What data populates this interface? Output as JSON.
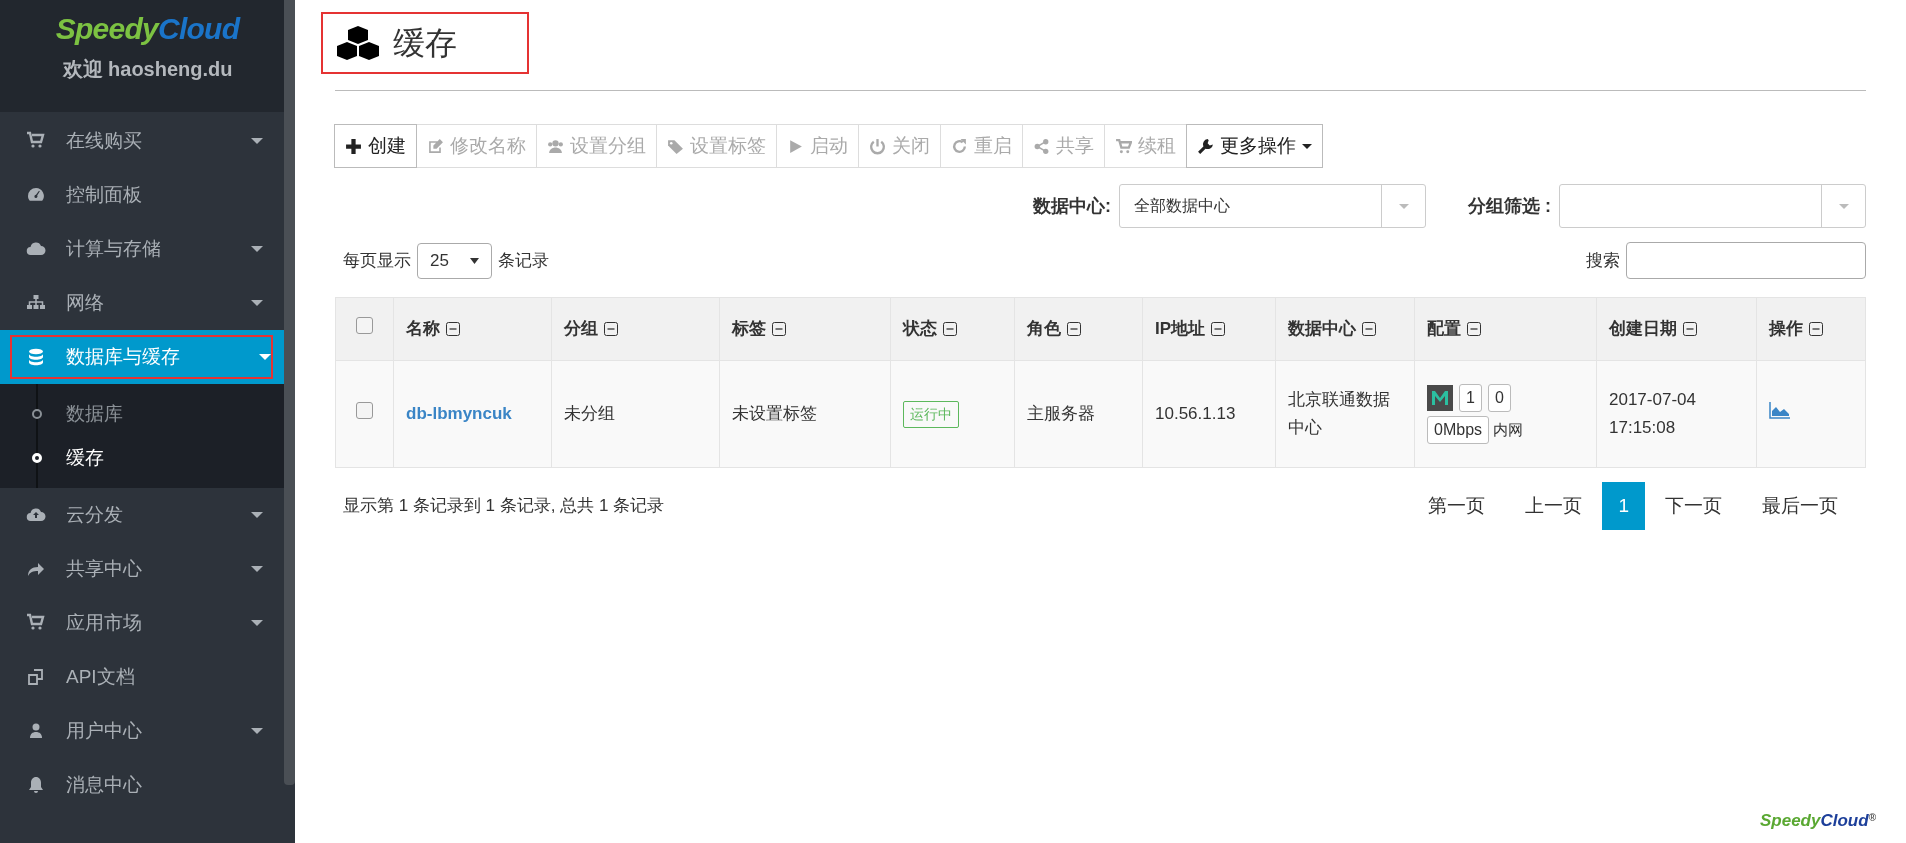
{
  "sidebar": {
    "logo": [
      "Speedy",
      "Cloud"
    ],
    "welcome": "欢迎 haosheng.du",
    "items": [
      {
        "label": "在线购买",
        "has_submenu": true,
        "selected": false,
        "outlined": false
      },
      {
        "label": "控制面板",
        "has_submenu": false,
        "selected": false,
        "outlined": false
      },
      {
        "label": "计算与存储",
        "has_submenu": true,
        "selected": false,
        "outlined": false
      },
      {
        "label": "网络",
        "has_submenu": true,
        "selected": false,
        "outlined": false
      },
      {
        "label": "数据库与缓存",
        "has_submenu": true,
        "selected": true,
        "outlined": true,
        "children": [
          {
            "label": "数据库",
            "selected": false
          },
          {
            "label": "缓存",
            "selected": true
          }
        ]
      },
      {
        "label": "云分发",
        "has_submenu": true,
        "selected": false,
        "outlined": false
      },
      {
        "label": "共享中心",
        "has_submenu": true,
        "selected": false,
        "outlined": false
      },
      {
        "label": "应用市场",
        "has_submenu": true,
        "selected": false,
        "outlined": false
      },
      {
        "label": "API文档",
        "has_submenu": false,
        "selected": false,
        "outlined": false
      },
      {
        "label": "用户中心",
        "has_submenu": true,
        "selected": false,
        "outlined": false
      },
      {
        "label": "消息中心",
        "has_submenu": false,
        "selected": false,
        "outlined": false
      }
    ]
  },
  "page_title": {
    "text": "缓存",
    "outlined": true
  },
  "toolbar": [
    {
      "label": "创建",
      "disabled": false
    },
    {
      "label": "修改名称",
      "disabled": true
    },
    {
      "label": "设置分组",
      "disabled": true
    },
    {
      "label": "设置标签",
      "disabled": true
    },
    {
      "label": "启动",
      "disabled": true
    },
    {
      "label": "关闭",
      "disabled": true
    },
    {
      "label": "重启",
      "disabled": true
    },
    {
      "label": "共享",
      "disabled": true
    },
    {
      "label": "续租",
      "disabled": true
    },
    {
      "label": "更多操作",
      "disabled": false
    }
  ],
  "filters": [
    {
      "label": "数据中心:",
      "value": "全部数据中心"
    },
    {
      "label": "分组筛选 :"
    }
  ],
  "page_size": {
    "prefix": "每页显示",
    "value": "25",
    "suffix": "条记录"
  },
  "search": {
    "label": "搜索"
  },
  "table": {
    "select_all_checked": false,
    "columns": [
      "名称",
      "分组",
      "标签",
      "状态",
      "角色",
      "IP地址",
      "数据中心",
      "配置",
      "创建日期",
      "操作"
    ],
    "rows": [
      {
        "checked": false,
        "name": "db-lbmyncuk",
        "group": "未分组",
        "tag": "未设置标签",
        "status": "运行中",
        "role": "主服务器",
        "ip": "10.56.1.13",
        "datacenter": "北京联通数据中心",
        "config": [
          "1",
          "0",
          "0Mbps",
          "内网"
        ],
        "created": "2017-07-04 17:15:08"
      }
    ]
  },
  "summary": "显示第 1 条记录到 1 条记录, 总共 1 条记录",
  "pagination": [
    {
      "label": "第一页",
      "selected": false
    },
    {
      "label": "上一页",
      "selected": false
    },
    {
      "label": "1",
      "selected": true
    },
    {
      "label": "下一页",
      "selected": false
    },
    {
      "label": "最后一页",
      "selected": false
    }
  ],
  "footer_logo": [
    "Speedy",
    "Cloud",
    "®"
  ]
}
